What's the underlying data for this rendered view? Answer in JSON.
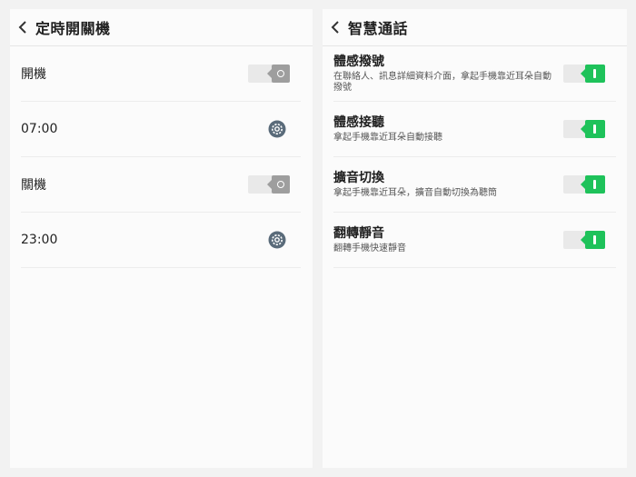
{
  "left_panel": {
    "title": "定時開關機",
    "rows": [
      {
        "label": "開機",
        "control": "toggle",
        "on": false
      },
      {
        "label": "07:00",
        "control": "gear-icon"
      },
      {
        "label": "關機",
        "control": "toggle",
        "on": false
      },
      {
        "label": "23:00",
        "control": "gear-icon"
      }
    ]
  },
  "right_panel": {
    "title": "智慧通話",
    "rows": [
      {
        "title": "體感撥號",
        "subtitle": "在聯絡人、訊息詳細資料介面，拿起手機靠近耳朵自動撥號",
        "on": true
      },
      {
        "title": "體感接聽",
        "subtitle": "拿起手機靠近耳朵自動接聽",
        "on": true
      },
      {
        "title": "擴音切換",
        "subtitle": "拿起手機靠近耳朵，擴音自動切換為聽筒",
        "on": true
      },
      {
        "title": "翻轉靜音",
        "subtitle": "翻轉手機快速靜音",
        "on": true
      }
    ]
  },
  "colors": {
    "toggle_on": "#1ec25a",
    "toggle_off": "#9e9e9e",
    "gear": "#5a6b7a"
  }
}
